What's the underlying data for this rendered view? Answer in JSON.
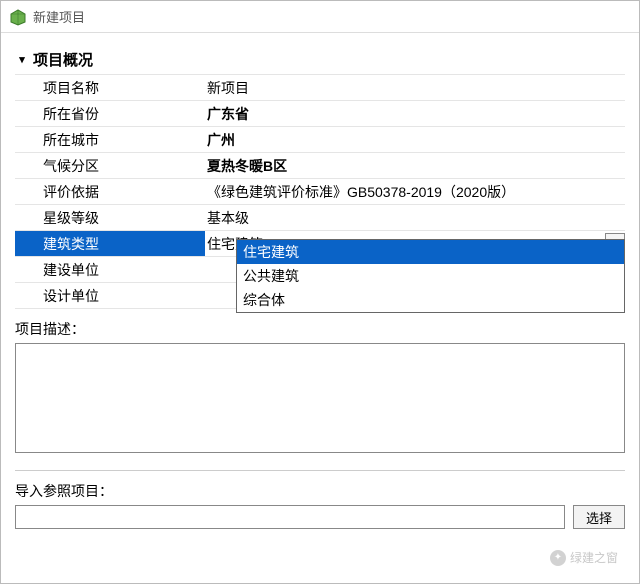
{
  "window": {
    "title": "新建项目"
  },
  "section": {
    "header": "项目概况"
  },
  "rows": {
    "name": {
      "label": "项目名称",
      "value": "新项目"
    },
    "province": {
      "label": "所在省份",
      "value": "广东省"
    },
    "city": {
      "label": "所在城市",
      "value": "广州"
    },
    "climate": {
      "label": "气候分区",
      "value": "夏热冬暖B区"
    },
    "basis": {
      "label": "评价依据",
      "value": "《绿色建筑评价标准》GB50378-2019（2020版）"
    },
    "star": {
      "label": "星级等级",
      "value": "基本级"
    },
    "btype": {
      "label": "建筑类型",
      "value": "住宅建筑"
    },
    "cons_unit": {
      "label": "建设单位",
      "value": ""
    },
    "design_unit": {
      "label": "设计单位",
      "value": ""
    }
  },
  "dropdown": {
    "options": [
      "住宅建筑",
      "公共建筑",
      "综合体"
    ],
    "selected_index": 0
  },
  "desc": {
    "label": "项目描述：",
    "value": ""
  },
  "import_ref": {
    "label": "导入参照项目：",
    "value": "",
    "button": "选择"
  },
  "watermark": {
    "text": "绿建之窗"
  }
}
